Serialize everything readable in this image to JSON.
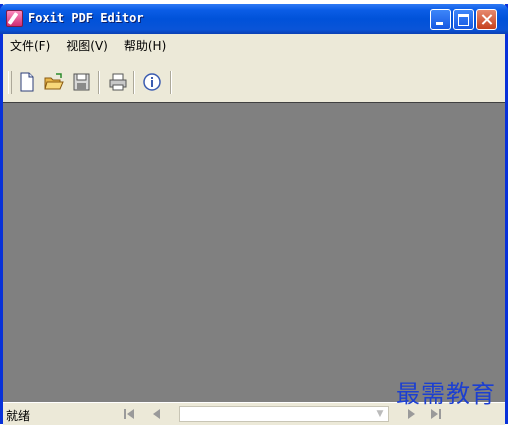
{
  "window": {
    "title": "Foxit PDF Editor"
  },
  "menu": [
    {
      "label": "文件(F)"
    },
    {
      "label": "视图(V)"
    },
    {
      "label": "帮助(H)"
    }
  ],
  "toolbar": {
    "icons": [
      "new-document-icon",
      "open-folder-icon",
      "save-icon",
      "print-icon",
      "about-info-icon"
    ]
  },
  "status": {
    "text": "就绪"
  },
  "watermark": "最需教育",
  "colors": {
    "titlebar": "#0052d9",
    "document_bg": "#808080",
    "chrome": "#ece9d8"
  }
}
